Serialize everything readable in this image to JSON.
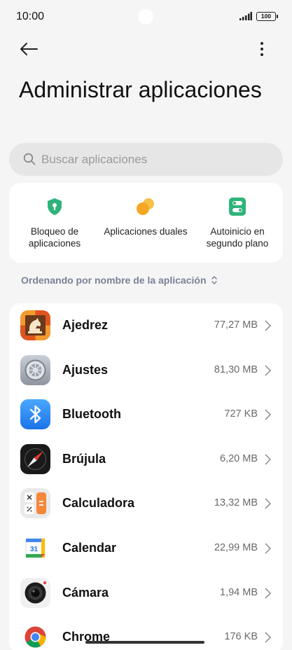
{
  "status": {
    "time": "10:00",
    "battery": "100"
  },
  "header": {
    "title": "Administrar aplicaciones"
  },
  "search": {
    "placeholder": "Buscar aplicaciones"
  },
  "quick_actions": [
    {
      "label": "Bloqueo de aplicaciones",
      "icon": "shield-lock-icon",
      "color": "#2fb37a"
    },
    {
      "label": "Aplicaciones duales",
      "icon": "dual-apps-icon",
      "color": "#f5a623"
    },
    {
      "label": "Autoinicio en segundo plano",
      "icon": "toggle-switch-icon",
      "color": "#2fb37a"
    }
  ],
  "sort": {
    "label": "Ordenando por nombre de la aplicación"
  },
  "apps": [
    {
      "name": "Ajedrez",
      "size": "77,27 MB",
      "icon": "chess-icon"
    },
    {
      "name": "Ajustes",
      "size": "81,30 MB",
      "icon": "settings-gear-icon"
    },
    {
      "name": "Bluetooth",
      "size": "727 KB",
      "icon": "bluetooth-icon"
    },
    {
      "name": "Brújula",
      "size": "6,20 MB",
      "icon": "compass-icon"
    },
    {
      "name": "Calculadora",
      "size": "13,32 MB",
      "icon": "calculator-icon"
    },
    {
      "name": "Calendar",
      "size": "22,99 MB",
      "icon": "calendar-icon",
      "calendar_day": "31"
    },
    {
      "name": "Cámara",
      "size": "1,94 MB",
      "icon": "camera-icon"
    },
    {
      "name": "Chrome",
      "size": "176 KB",
      "icon": "chrome-icon"
    }
  ]
}
